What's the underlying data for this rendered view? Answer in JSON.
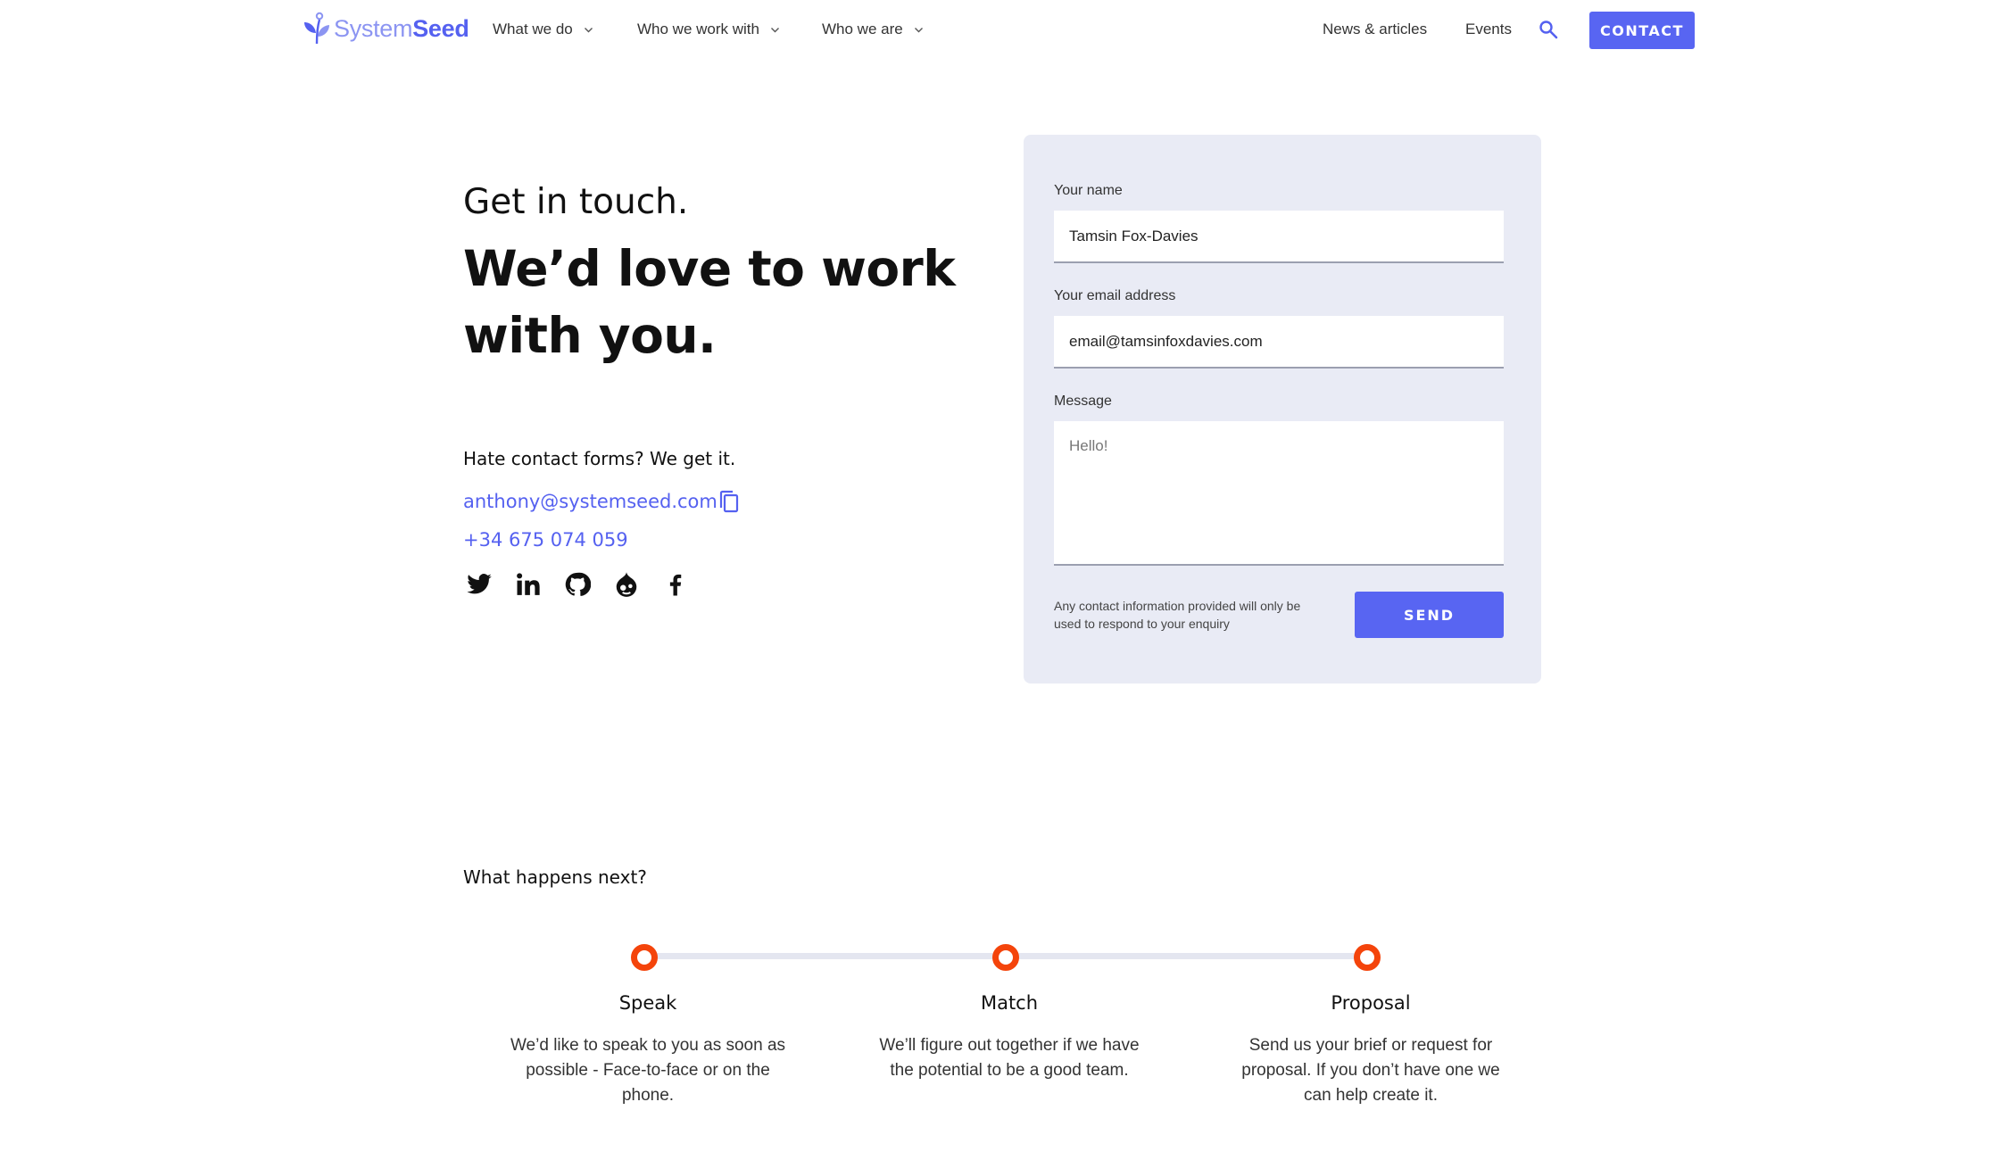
{
  "header": {
    "logo": {
      "system": "System",
      "seed": "Seed"
    },
    "nav": [
      {
        "label": "What we do",
        "dropdown": true
      },
      {
        "label": "Who we work with",
        "dropdown": true
      },
      {
        "label": "Who we are",
        "dropdown": true
      },
      {
        "label": "News & articles",
        "dropdown": false
      },
      {
        "label": "Events",
        "dropdown": false
      }
    ],
    "search_icon": "search-icon",
    "contact_label": "CONTACT"
  },
  "hero": {
    "subtitle": "Get in touch.",
    "title": "We’d love to work with you.",
    "hate_text": "Hate contact forms? We get it.",
    "email": "anthony@systemseed.com",
    "phone": "+34 675 074 059",
    "social": [
      "twitter-icon",
      "linkedin-icon",
      "github-icon",
      "drupal-icon",
      "facebook-icon"
    ]
  },
  "form": {
    "name_label": "Your name",
    "name_value": "Tamsin Fox-Davies",
    "email_label": "Your email address",
    "email_value": "email@tamsinfoxdavies.com",
    "message_label": "Message",
    "message_placeholder": "Hello!",
    "disclaimer": "Any contact information provided will only be used to respond to your enquiry",
    "send_label": "SEND"
  },
  "next": {
    "title": "What happens next?",
    "steps": [
      {
        "title": "Speak",
        "desc": "We’d like to speak to you as soon as possible - Face-to-face or on the phone."
      },
      {
        "title": "Match",
        "desc": "We’ll figure out together if we have the potential to be a good team."
      },
      {
        "title": "Proposal",
        "desc": "Send us your brief or request for proposal. If you don’t have one we can help create it."
      }
    ]
  },
  "colors": {
    "accent": "#5865f2",
    "timeline_dot": "#f4440b",
    "card_bg": "#e9ebf5",
    "link": "#5561f0"
  }
}
